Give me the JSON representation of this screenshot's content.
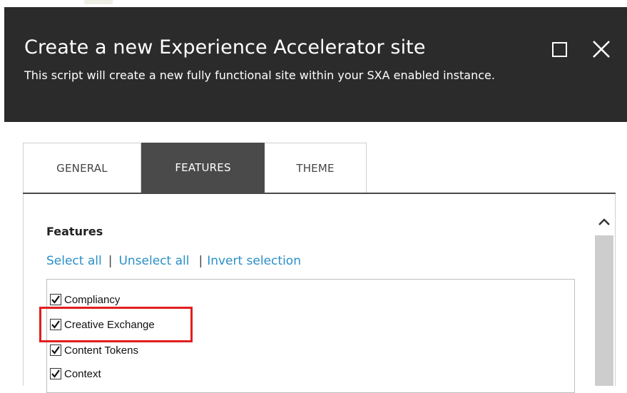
{
  "dialog": {
    "title": "Create a new Experience Accelerator site",
    "subtitle": "This script will create a new fully functional site within your SXA enabled instance.",
    "maximize_icon": "maximize-icon",
    "close_icon": "close-icon"
  },
  "tabs": [
    {
      "label": "GENERAL",
      "active": false
    },
    {
      "label": "FEATURES",
      "active": true
    },
    {
      "label": "THEME",
      "active": false
    }
  ],
  "features": {
    "heading": "Features",
    "links": {
      "select_all": "Select all",
      "separator": "|",
      "unselect_all": "Unselect all",
      "invert_selection": "Invert selection"
    },
    "items": [
      {
        "label": "Compliancy",
        "checked": true
      },
      {
        "label": "Creative Exchange",
        "checked": true,
        "highlighted": true
      },
      {
        "label": "Content Tokens",
        "checked": true
      },
      {
        "label": "Context",
        "checked": true
      }
    ]
  },
  "colors": {
    "header_bg": "#2b2b2b",
    "active_tab_bg": "#4a4a4a",
    "link": "#2a8fc7",
    "highlight": "#e01f1f",
    "scrollbar": "#cdcdcd"
  }
}
